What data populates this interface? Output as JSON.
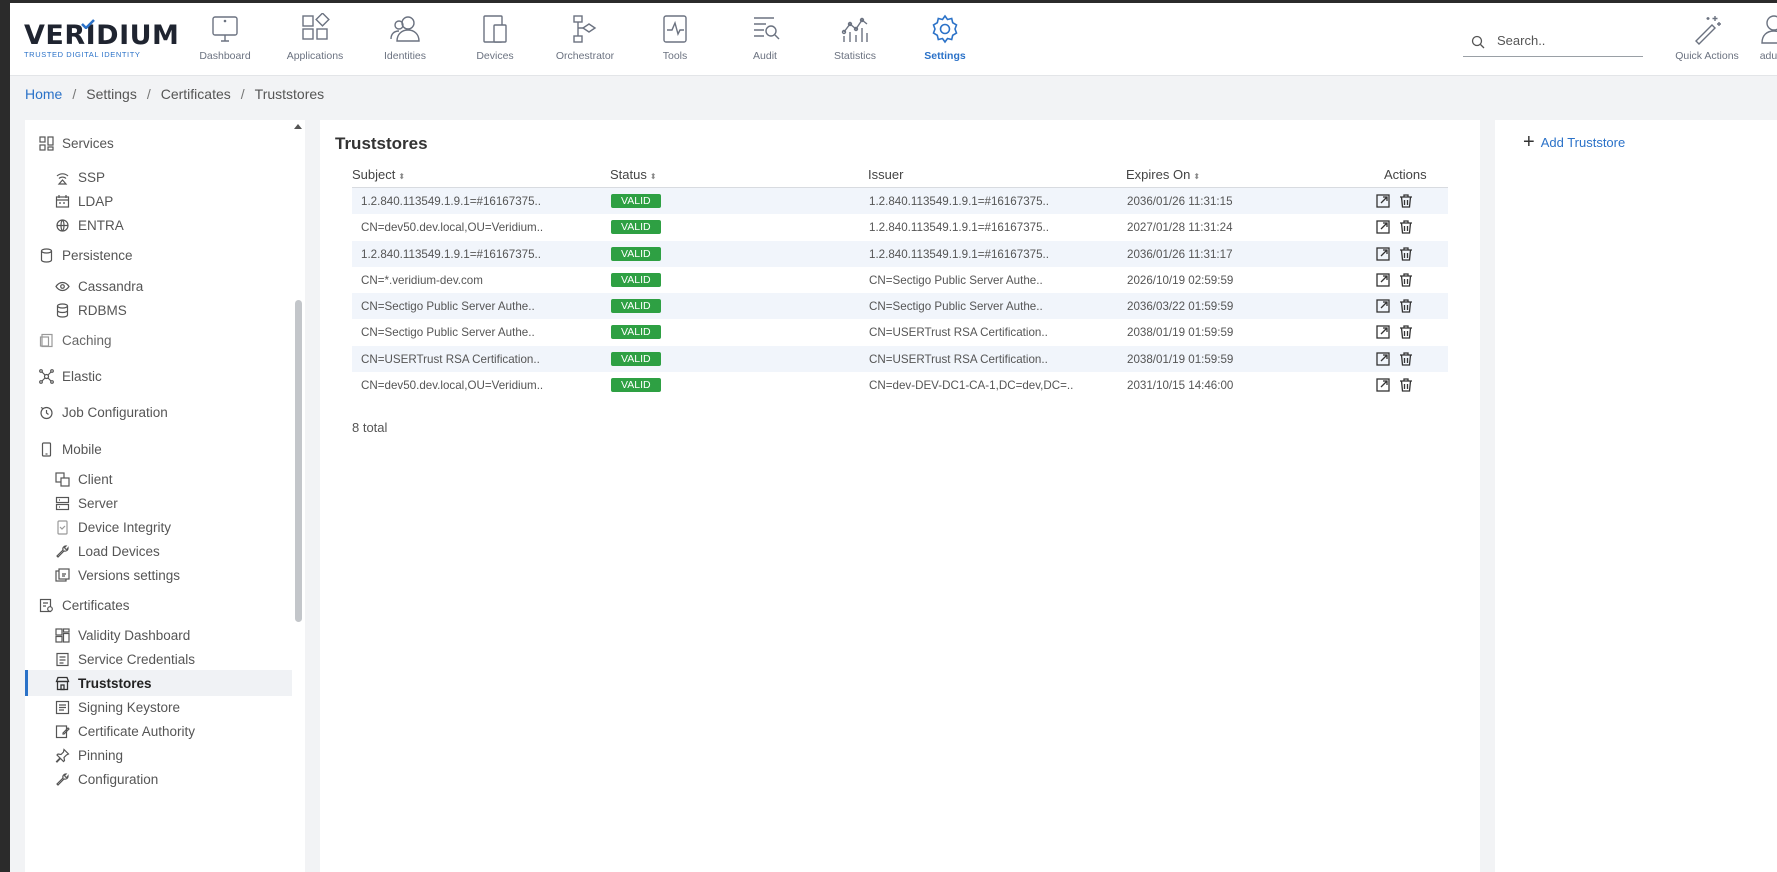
{
  "header": {
    "logo": {
      "word": "VERIDIUM",
      "tagline": "TRUSTED DIGITAL IDENTITY"
    },
    "nav": [
      {
        "label": "Dashboard",
        "icon": "monitor-icon"
      },
      {
        "label": "Applications",
        "icon": "apps-icon"
      },
      {
        "label": "Identities",
        "icon": "users-icon"
      },
      {
        "label": "Devices",
        "icon": "devices-icon"
      },
      {
        "label": "Orchestrator",
        "icon": "flow-icon"
      },
      {
        "label": "Tools",
        "icon": "tools-icon"
      },
      {
        "label": "Audit",
        "icon": "audit-icon"
      },
      {
        "label": "Statistics",
        "icon": "statistics-icon"
      },
      {
        "label": "Settings",
        "icon": "gear-icon",
        "active": true
      }
    ],
    "search_placeholder": "Search..",
    "quick_actions": "Quick Actions",
    "user": "aduse"
  },
  "breadcrumb": {
    "home": "Home",
    "sep": "/",
    "items": [
      "Settings",
      "Certificates",
      "Truststores"
    ]
  },
  "sidebar": {
    "items": [
      {
        "label": "Services",
        "level": "group"
      },
      {
        "label": "SSP",
        "level": "sub"
      },
      {
        "label": "LDAP",
        "level": "sub"
      },
      {
        "label": "ENTRA",
        "level": "sub"
      },
      {
        "label": "Persistence",
        "level": "group"
      },
      {
        "label": "Cassandra",
        "level": "sub"
      },
      {
        "label": "RDBMS",
        "level": "sub"
      },
      {
        "label": "Caching",
        "level": "group"
      },
      {
        "label": "Elastic",
        "level": "group"
      },
      {
        "label": "Job Configuration",
        "level": "group"
      },
      {
        "label": "Mobile",
        "level": "group"
      },
      {
        "label": "Client",
        "level": "sub"
      },
      {
        "label": "Server",
        "level": "sub"
      },
      {
        "label": "Device Integrity",
        "level": "sub"
      },
      {
        "label": "Load Devices",
        "level": "sub"
      },
      {
        "label": "Versions settings",
        "level": "sub"
      },
      {
        "label": "Certificates",
        "level": "group"
      },
      {
        "label": "Validity Dashboard",
        "level": "sub"
      },
      {
        "label": "Service Credentials",
        "level": "sub"
      },
      {
        "label": "Truststores",
        "level": "sub",
        "active": true
      },
      {
        "label": "Signing Keystore",
        "level": "sub"
      },
      {
        "label": "Certificate Authority",
        "level": "sub"
      },
      {
        "label": "Pinning",
        "level": "sub"
      },
      {
        "label": "Configuration",
        "level": "sub"
      }
    ]
  },
  "main": {
    "title": "Truststores",
    "columns": {
      "subject": "Subject",
      "status": "Status",
      "issuer": "Issuer",
      "expires": "Expires On",
      "actions": "Actions"
    },
    "rows": [
      {
        "subject": "1.2.840.113549.1.9.1=#16167375..",
        "status": "VALID",
        "issuer": "1.2.840.113549.1.9.1=#16167375..",
        "expires": "2036/01/26 11:31:15"
      },
      {
        "subject": "CN=dev50.dev.local,OU=Veridium..",
        "status": "VALID",
        "issuer": "1.2.840.113549.1.9.1=#16167375..",
        "expires": "2027/01/28 11:31:24"
      },
      {
        "subject": "1.2.840.113549.1.9.1=#16167375..",
        "status": "VALID",
        "issuer": "1.2.840.113549.1.9.1=#16167375..",
        "expires": "2036/01/26 11:31:17"
      },
      {
        "subject": "CN=*.veridium-dev.com",
        "status": "VALID",
        "issuer": "CN=Sectigo Public Server Authe..",
        "expires": "2026/10/19 02:59:59"
      },
      {
        "subject": "CN=Sectigo Public Server Authe..",
        "status": "VALID",
        "issuer": "CN=Sectigo Public Server Authe..",
        "expires": "2036/03/22 01:59:59"
      },
      {
        "subject": "CN=Sectigo Public Server Authe..",
        "status": "VALID",
        "issuer": "CN=USERTrust RSA Certification..",
        "expires": "2038/01/19 01:59:59"
      },
      {
        "subject": "CN=USERTrust RSA Certification..",
        "status": "VALID",
        "issuer": "CN=USERTrust RSA Certification..",
        "expires": "2038/01/19 01:59:59"
      },
      {
        "subject": "CN=dev50.dev.local,OU=Veridium..",
        "status": "VALID",
        "issuer": "CN=dev-DEV-DC1-CA-1,DC=dev,DC=..",
        "expires": "2031/10/15 14:46:00"
      }
    ],
    "total": "8 total"
  },
  "right": {
    "add_label": "Add Truststore"
  },
  "colors": {
    "accent": "#2b72c8",
    "valid": "#2ea043"
  }
}
